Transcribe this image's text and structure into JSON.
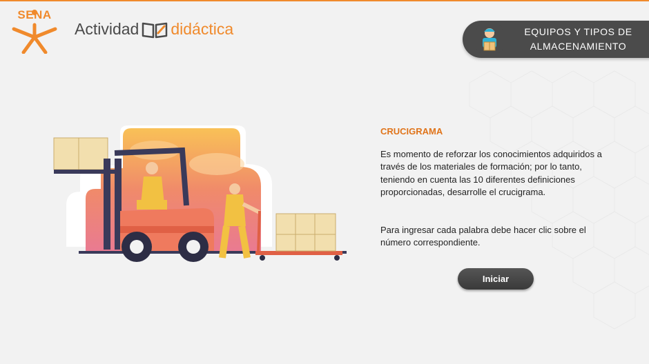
{
  "header": {
    "sena_logo_text": "SENA",
    "brand_word1": "Actividad",
    "brand_word2": "didáctica",
    "topic_title_line1": "EQUIPOS Y TIPOS DE",
    "topic_title_line2": "ALMACENAMIENTO",
    "topic_icon": "worker-with-box-icon"
  },
  "main": {
    "title": "CRUCIGRAMA",
    "paragraph1": "Es momento de reforzar los conocimientos adquiridos a través de los materiales de formación; por lo tanto, teniendo en cuenta las 10 diferentes definiciones proporcionadas, desarrolle el crucigrama.",
    "paragraph2": "Para ingresar cada palabra debe hacer clic sobre el número correspondiente.",
    "start_button": "Iniciar",
    "illustration": "forklift-and-pallet-jack-workers-illustration"
  },
  "colors": {
    "accent": "#f08a2c",
    "title": "#e0741a",
    "pill": "#4b4b4b",
    "background": "#f2f2f2"
  }
}
